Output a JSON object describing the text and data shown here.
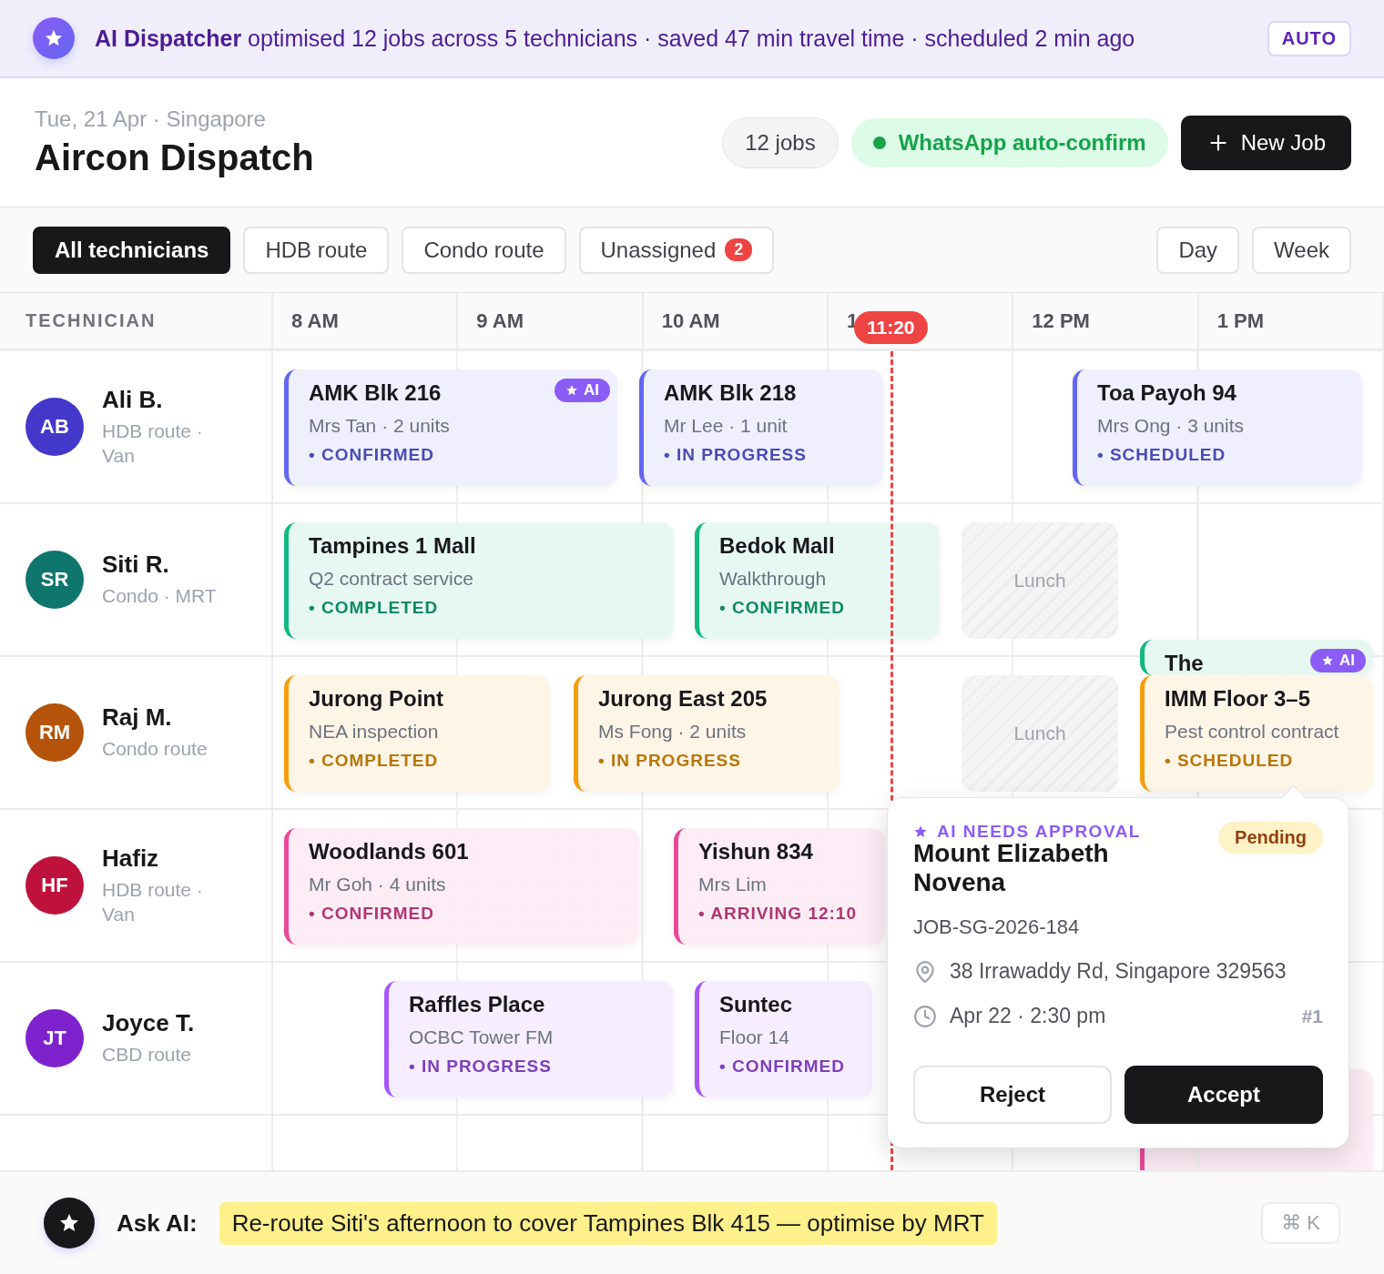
{
  "banner": {
    "text": "**AI Dispatcher** optimised 12 jobs across 5 technicians · saved 47 min travel time · scheduled 2 min ago",
    "mode": "AUTO"
  },
  "header": {
    "subtitle": "Tue, 21 Apr · Singapore",
    "title": "Aircon Dispatch",
    "count": "12 jobs",
    "whatsapp": "WhatsApp auto-confirm",
    "new_job": "New Job"
  },
  "filters": [
    {
      "label": "All technicians",
      "selected": true
    },
    {
      "label": "HDB route",
      "selected": false
    },
    {
      "label": "Condo route",
      "selected": false
    },
    {
      "label": "Unassigned",
      "selected": false,
      "count": "2"
    }
  ],
  "views": [
    {
      "label": "Day",
      "selected": false
    },
    {
      "label": "Week",
      "selected": false
    }
  ],
  "schedule": {
    "column_title": "TECHNICIAN",
    "hours": [
      "8 AM",
      "9 AM",
      "10 AM",
      "1",
      "12 PM",
      "1 PM"
    ],
    "now": "11:20",
    "technicians": [
      {
        "initials": "AB",
        "color": "#4338ca",
        "name": "Ali B.",
        "meta": "HDB route · Van",
        "jobs": [
          {
            "kind": "job",
            "title": "AMK Blk 216",
            "detail": "Mrs Tan · 2 units",
            "status": "• CONFIRMED",
            "color": "#6366f1",
            "badge": "AI"
          },
          {
            "kind": "job",
            "title": "AMK Blk 218",
            "detail": "Mr Lee · 1 unit",
            "status": "• IN PROGRESS",
            "color": "#6366f1"
          },
          {
            "kind": "job",
            "title": "Toa Payoh 94",
            "detail": "Mrs Ong · 3 units",
            "status": "• SCHEDULED",
            "color": "#6366f1"
          }
        ]
      },
      {
        "initials": "SR",
        "color": "#0f766e",
        "name": "Siti R.",
        "meta": "Condo · MRT",
        "jobs": [
          {
            "kind": "job",
            "title": "Tampines 1 Mall",
            "detail": "Q2 contract service",
            "status": "• COMPLETED",
            "color": "#10b981"
          },
          {
            "kind": "job",
            "title": "Bedok Mall",
            "detail": "Walkthrough",
            "status": "• CONFIRMED",
            "color": "#10b981"
          },
          {
            "kind": "lunch",
            "title": "Lunch"
          }
        ]
      },
      {
        "initials": "RM",
        "color": "#b45309",
        "name": "Raj M.",
        "meta": "Condo route",
        "jobs": [
          {
            "kind": "job",
            "title": "Jurong Point",
            "detail": "NEA inspection",
            "status": "• COMPLETED",
            "color": "#f59e0b"
          },
          {
            "kind": "job",
            "title": "Jurong East 205",
            "detail": "Ms Fong · 2 units",
            "status": "• IN PROGRESS",
            "color": "#f59e0b"
          },
          {
            "kind": "lunch",
            "title": "Lunch"
          },
          {
            "kind": "job",
            "title": "The",
            "color": "#10b981",
            "badge": "AI"
          },
          {
            "kind": "job",
            "title": "IMM Floor 3–5",
            "detail": "Pest control contract",
            "status": "• SCHEDULED",
            "color": "#f59e0b"
          }
        ]
      },
      {
        "initials": "HF",
        "color": "#be123c",
        "name": "Hafiz",
        "meta": "HDB route · Van",
        "jobs": [
          {
            "kind": "job",
            "title": "Woodlands 601",
            "detail": "Mr Goh · 4 units",
            "status": "• CONFIRMED",
            "color": "#ec4899"
          },
          {
            "kind": "job",
            "title": "Yishun 834",
            "detail": "Mrs Lim",
            "status": "• ARRIVING 12:10",
            "color": "#ec4899"
          }
        ]
      },
      {
        "initials": "JT",
        "color": "#7e22ce",
        "name": "Joyce T.",
        "meta": "CBD route",
        "jobs": [
          {
            "kind": "job",
            "title": "Raffles Place",
            "detail": "OCBC Tower FM",
            "status": "• IN PROGRESS",
            "color": "#a855f7"
          },
          {
            "kind": "job",
            "title": "Suntec",
            "detail": "Floor 14",
            "status": "• CONFIRMED",
            "color": "#a855f7"
          },
          {
            "kind": "job",
            "color": "#ec4899"
          }
        ]
      }
    ]
  },
  "approval": {
    "label": "AI NEEDS APPROVAL",
    "status": "Pending",
    "title": "Mount Elizabeth Novena",
    "job_id": "JOB-SG-2026-184",
    "address": "38 Irrawaddy Rd, Singapore 329563",
    "time": "Apr 22 · 2:30 pm",
    "rank": "#1",
    "reject": "Reject",
    "accept": "Accept"
  },
  "ask": {
    "label": "Ask AI:",
    "prompt": "Re-route Siti's afternoon to cover Tampines Blk 415 — optimise by MRT",
    "shortcut": "⌘ K"
  }
}
